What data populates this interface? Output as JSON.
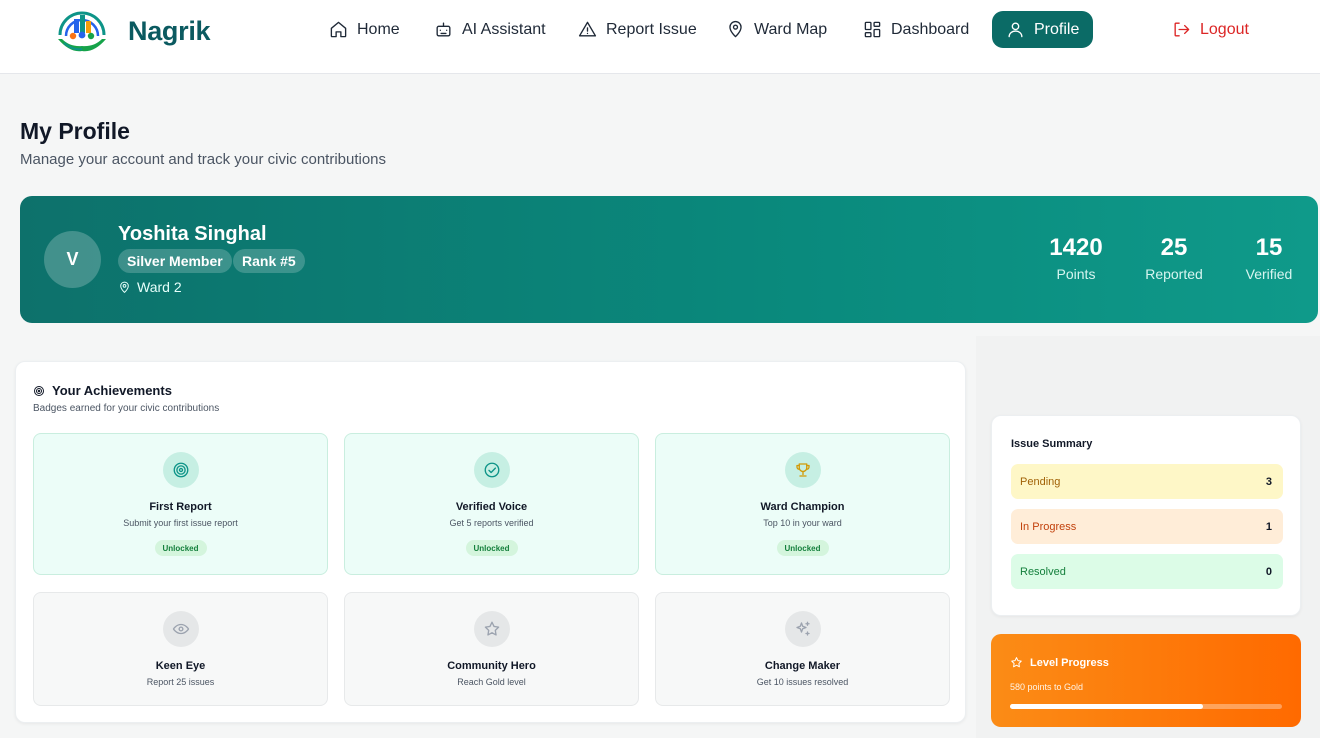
{
  "brand": {
    "name": "Nagrik"
  },
  "nav": {
    "items": [
      {
        "label": "Home",
        "icon": "home-icon"
      },
      {
        "label": "AI Assistant",
        "icon": "robot-icon"
      },
      {
        "label": "Report Issue",
        "icon": "warning-icon"
      },
      {
        "label": "Ward Map",
        "icon": "map-pin-icon"
      },
      {
        "label": "Dashboard",
        "icon": "grid-icon"
      },
      {
        "label": "Profile",
        "icon": "user-icon",
        "active": true
      }
    ],
    "logout": {
      "label": "Logout",
      "icon": "logout-icon"
    }
  },
  "header": {
    "title": "My Profile",
    "subtitle": "Manage your account and track your civic contributions"
  },
  "profile": {
    "initial": "V",
    "name": "Yoshita Singhal",
    "membership": "Silver Member",
    "rank": "Rank #5",
    "ward": "Ward 2",
    "stats": [
      {
        "value": "1420",
        "label": "Points"
      },
      {
        "value": "25",
        "label": "Reported"
      },
      {
        "value": "15",
        "label": "Verified"
      }
    ]
  },
  "achievements": {
    "title": "Your Achievements",
    "subtitle": "Badges earned for your civic contributions",
    "badges": [
      {
        "name": "First Report",
        "desc": "Submit your first issue report",
        "status": "Unlocked",
        "icon": "target-icon"
      },
      {
        "name": "Verified Voice",
        "desc": "Get 5 reports verified",
        "status": "Unlocked",
        "icon": "check-circle-icon"
      },
      {
        "name": "Ward Champion",
        "desc": "Top 10 in your ward",
        "status": "Unlocked",
        "icon": "trophy-icon"
      },
      {
        "name": "Keen Eye",
        "desc": "Report 25 issues",
        "status": "",
        "icon": "eye-icon"
      },
      {
        "name": "Community Hero",
        "desc": "Reach Gold level",
        "status": "",
        "icon": "star-icon"
      },
      {
        "name": "Change Maker",
        "desc": "Get 10 issues resolved",
        "status": "",
        "icon": "sparkles-icon"
      }
    ]
  },
  "issue_summary": {
    "title": "Issue Summary",
    "rows": [
      {
        "label": "Pending",
        "value": "3"
      },
      {
        "label": "In Progress",
        "value": "1"
      },
      {
        "label": "Resolved",
        "value": "0"
      }
    ]
  },
  "level_progress": {
    "title": "Level Progress",
    "subtitle": "580 points to Gold",
    "progress_fraction": 0.71
  },
  "colors": {
    "primary": "#0b6b66",
    "banner": "#0a8a7d",
    "logout": "#dc2626",
    "level_orange": "#ff6a00",
    "unlocked_tag": "#15803d"
  }
}
